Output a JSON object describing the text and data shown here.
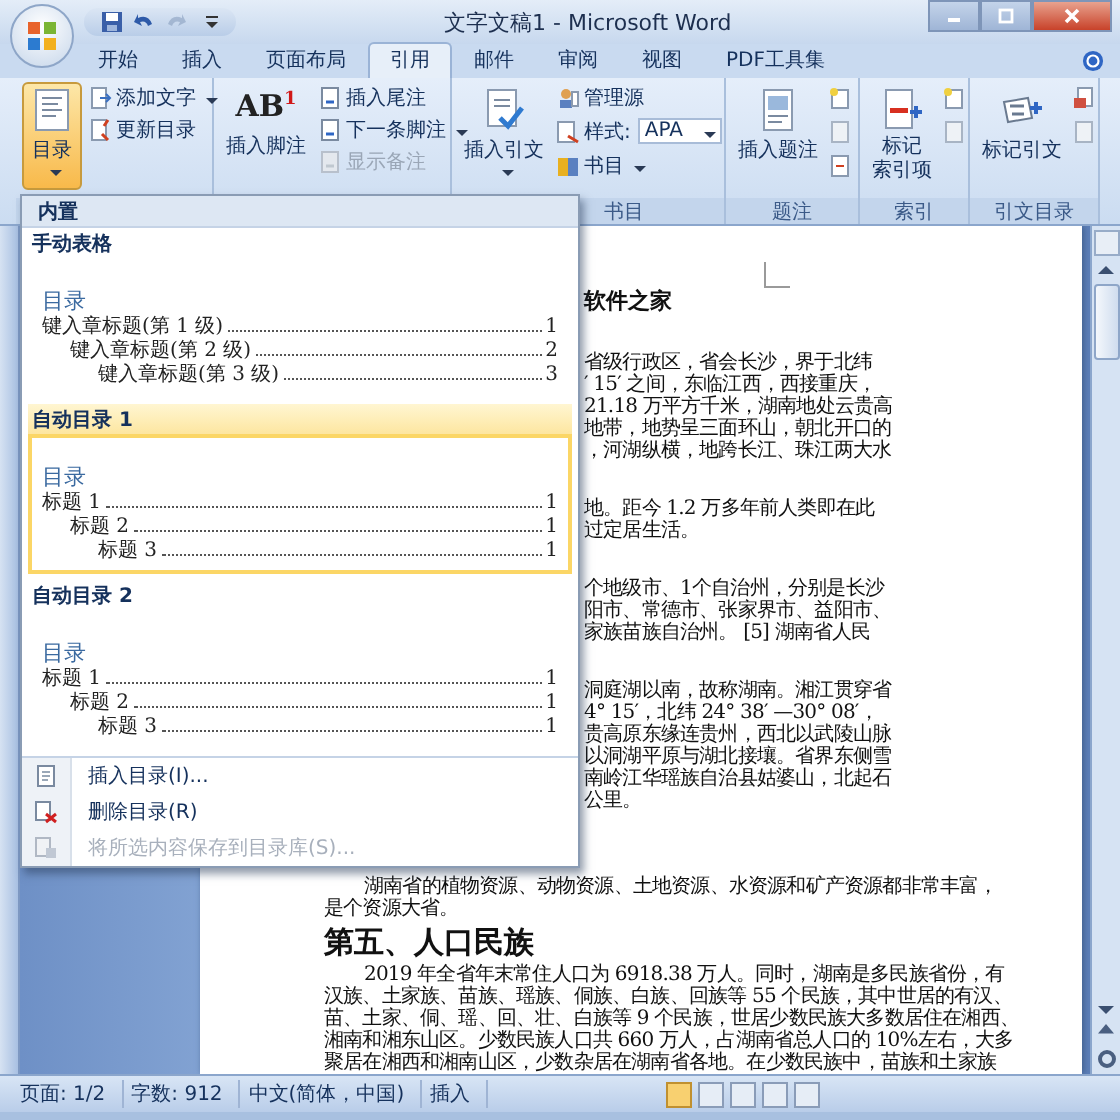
{
  "window": {
    "title": "文字文稿1 - Microsoft Word"
  },
  "tabs": [
    {
      "label": "开始",
      "selected": false
    },
    {
      "label": "插入",
      "selected": false
    },
    {
      "label": "页面布局",
      "selected": false
    },
    {
      "label": "引用",
      "selected": true
    },
    {
      "label": "邮件",
      "selected": false
    },
    {
      "label": "审阅",
      "selected": false
    },
    {
      "label": "视图",
      "selected": false
    },
    {
      "label": "PDF工具集",
      "selected": false
    }
  ],
  "ribbon": {
    "toc": {
      "button": {
        "label": "目录",
        "selected": true
      },
      "items": [
        {
          "label": "添加文字"
        },
        {
          "label": "更新目录"
        }
      ]
    },
    "footnotes": {
      "glyph": "AB$^{1}$",
      "button": {
        "label": "插入脚注"
      },
      "items": [
        {
          "label": "插入尾注",
          "disabled": false
        },
        {
          "label": "下一条脚注",
          "disabled": false
        },
        {
          "label": "显示备注",
          "disabled": true
        }
      ]
    },
    "citations": {
      "label": "书目",
      "button": {
        "label": "插入引文"
      },
      "manage": "管理源",
      "style_label": "样式:",
      "style_value": "APA",
      "bibliography": "书目"
    },
    "captions": {
      "label": "题注",
      "button": {
        "label": "插入题注"
      }
    },
    "index": {
      "label": "索引",
      "button": {
        "lines": [
          "标记",
          "索引项"
        ]
      }
    },
    "authorities": {
      "label": "引文目录",
      "button": {
        "label": "标记引文"
      }
    }
  },
  "toc_menu": {
    "header": "内置",
    "gallery": [
      {
        "title": "手动表格",
        "selected": false,
        "preview": {
          "heading": "目录",
          "entries": [
            {
              "text": "键入章标题(第 1 级)",
              "page": "1",
              "children": [
                {
                  "text": "键入章标题(第 2 级)",
                  "page": "2",
                  "children": [
                    {
                      "text": "键入章标题(第 3 级)",
                      "page": "3"
                    }
                  ]
                }
              ]
            }
          ]
        }
      },
      {
        "title": "自动目录 1",
        "selected": true,
        "preview": {
          "heading": "目录",
          "entries": [
            {
              "text": "标题 1",
              "page": "1",
              "children": [
                {
                  "text": "标题 2",
                  "page": "1",
                  "children": [
                    {
                      "text": "标题 3",
                      "page": "1"
                    }
                  ]
                }
              ]
            }
          ]
        }
      },
      {
        "title": "自动目录 2",
        "selected": false,
        "preview": {
          "heading": "目录",
          "entries": [
            {
              "text": "标题 1",
              "page": "1",
              "children": [
                {
                  "text": "标题 2",
                  "page": "1",
                  "children": [
                    {
                      "text": "标题 3",
                      "page": "1"
                    }
                  ]
                }
              ]
            }
          ]
        }
      }
    ],
    "commands": [
      {
        "label": "插入目录(I)...",
        "disabled": false
      },
      {
        "label": "删除目录(R)",
        "disabled": false
      },
      {
        "label": "将所选内容保存到目录库(S)...",
        "disabled": true
      }
    ]
  },
  "document": {
    "partial_blocks": [
      {
        "kind": "heading",
        "lines": [
          "软件之家"
        ]
      },
      {
        "kind": "paragraph",
        "lines": [
          "省级行政区，省会长沙，界于北纬",
          "′ 15′ 之间，东临江西，西接重庆，",
          "21.18 万平方千米，湖南地处云贵高",
          "地带，地势呈三面环山，朝北开口的",
          "，河湖纵横，地跨长江、珠江两大水"
        ]
      },
      {
        "kind": "paragraph",
        "lines": [
          "地。距今 1.2 万多年前人类即在此",
          "过定居生活。"
        ]
      },
      {
        "kind": "paragraph",
        "lines": [
          "个地级市、1个自治州，分别是长沙",
          "阳市、常德市、张家界市、益阳市、",
          "家族苗族自治州。 [5] 湖南省人民"
        ]
      },
      {
        "kind": "paragraph",
        "lines": [
          "洞庭湖以南，故称湖南。湘江贯穿省",
          "4° 15′，北纬 24° 38′ —30° 08′，",
          "贵高原东缘连贵州，西北以武陵山脉",
          "以洞湖平原与湖北接壤。省界东侧雪",
          "南岭江华瑶族自治县姑婆山，北起石",
          "公里。"
        ]
      }
    ],
    "blocks": [
      {
        "kind": "paragraph",
        "lines": [
          "湖南省的植物资源、动物资源、土地资源、水资源和矿产资源都非常丰富，",
          "是个资源大省。"
        ]
      },
      {
        "kind": "heading",
        "lines": [
          "第五、人口民族"
        ]
      },
      {
        "kind": "paragraph",
        "lines": [
          "2019 年全省年末常住人口为 6918.38 万人。同时，湖南是多民族省份，有",
          "汉族、土家族、苗族、瑶族、侗族、白族、回族等 55 个民族，其中世居的有汉、",
          "苗、土家、侗、瑶、回、壮、白族等 9 个民族，世居少数民族大多数居住在湘西、",
          "湘南和湘东山区。少数民族人口共 660 万人，占湖南省总人口的 10%左右，大多",
          "聚居在湘西和湘南山区，少数杂居在湖南省各地。在少数民族中，苗族和土家族"
        ]
      }
    ]
  },
  "status_bar": {
    "page": "页面: 1/2",
    "words": "字数: 912",
    "language": "中文(简体，中国)",
    "mode": "插入"
  }
}
